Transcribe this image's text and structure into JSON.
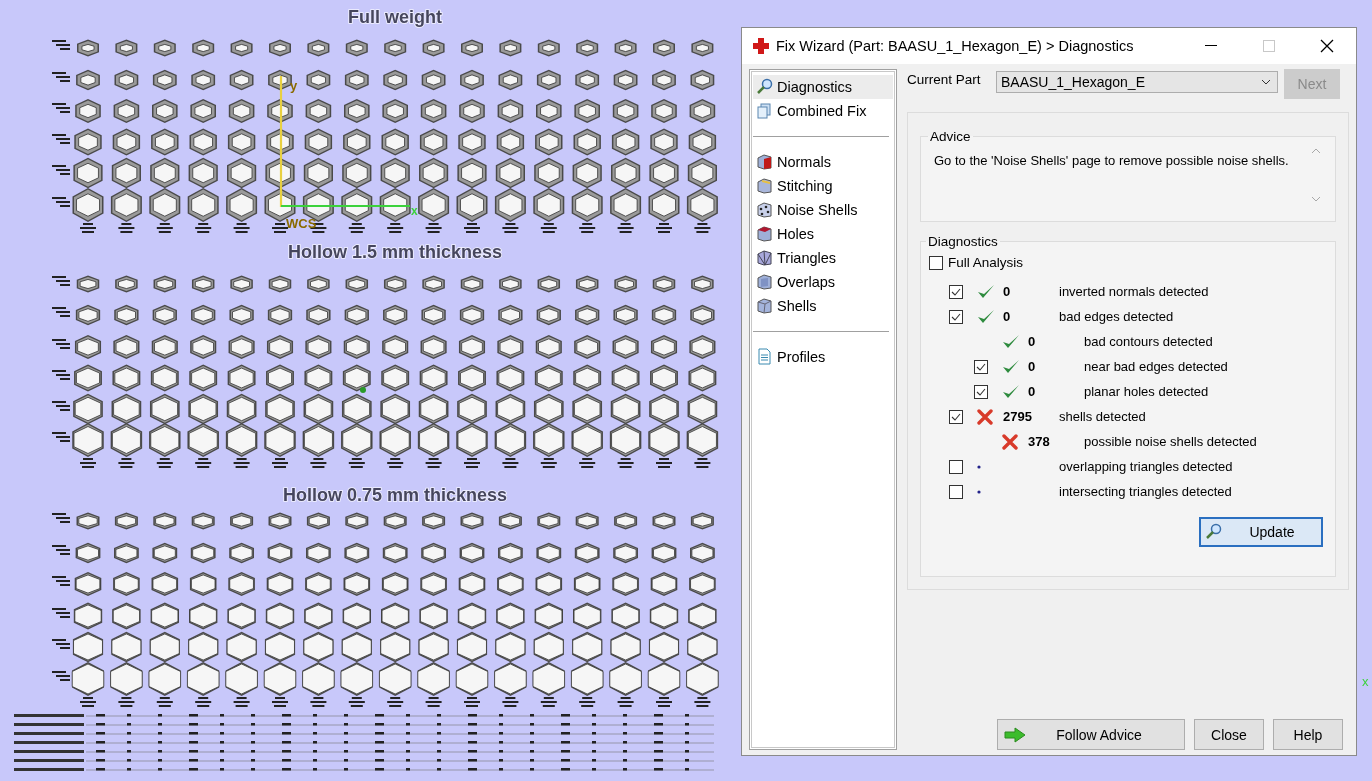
{
  "viewport": {
    "sections": [
      {
        "title": "Full weight"
      },
      {
        "title": "Hollow 1.5 mm thickness"
      },
      {
        "title": "Hollow 0.75 mm thickness"
      }
    ],
    "axis": {
      "y": "y",
      "x": "x",
      "origin": "WCS"
    },
    "corner_axis": "x"
  },
  "window": {
    "title": "Fix Wizard (Part: BAASU_1_Hexagon_E) > Diagnostics"
  },
  "nav": {
    "groups": [
      [
        {
          "label": "Diagnostics",
          "selected": true
        },
        {
          "label": "Combined Fix",
          "selected": false
        }
      ],
      [
        {
          "label": "Normals",
          "selected": false
        },
        {
          "label": "Stitching",
          "selected": false
        },
        {
          "label": "Noise Shells",
          "selected": false
        },
        {
          "label": "Holes",
          "selected": false
        },
        {
          "label": "Triangles",
          "selected": false
        },
        {
          "label": "Overlaps",
          "selected": false
        },
        {
          "label": "Shells",
          "selected": false
        }
      ],
      [
        {
          "label": "Profiles",
          "selected": false
        }
      ]
    ]
  },
  "current_part": {
    "label": "Current Part",
    "value": "BAASU_1_Hexagon_E"
  },
  "next_button": {
    "label": "Next",
    "disabled": true
  },
  "advice": {
    "title": "Advice",
    "text": "Go to the 'Noise Shells' page to remove possible noise shells."
  },
  "diagnostics": {
    "title": "Diagnostics",
    "full_analysis": {
      "label": "Full Analysis",
      "checked": false
    },
    "rows": [
      {
        "kind": "ok",
        "checkable": true,
        "checked": true,
        "count": "0",
        "label": "inverted normals detected"
      },
      {
        "kind": "ok",
        "checkable": true,
        "checked": true,
        "count": "0",
        "label": "bad edges detected",
        "children": [
          {
            "kind": "ok",
            "checkable": false,
            "count": "0",
            "label": "bad contours detected"
          },
          {
            "kind": "ok",
            "checkable": true,
            "checked": true,
            "count": "0",
            "label": "near bad edges detected"
          },
          {
            "kind": "ok",
            "checkable": true,
            "checked": true,
            "count": "0",
            "label": "planar holes detected"
          }
        ]
      },
      {
        "kind": "error",
        "checkable": true,
        "checked": true,
        "count": "2795",
        "label": "shells detected",
        "children": [
          {
            "kind": "error",
            "checkable": false,
            "count": "378",
            "label": "possible noise shells detected"
          }
        ]
      },
      {
        "kind": "pending",
        "checkable": true,
        "checked": false,
        "label": "overlapping triangles detected"
      },
      {
        "kind": "pending",
        "checkable": true,
        "checked": false,
        "label": "intersecting triangles detected"
      }
    ],
    "update_button": "Update"
  },
  "buttons": [
    {
      "label": "Follow Advice",
      "kind": "follow"
    },
    {
      "label": "Close",
      "kind": "plain"
    },
    {
      "label": "Help",
      "kind": "plain"
    }
  ]
}
